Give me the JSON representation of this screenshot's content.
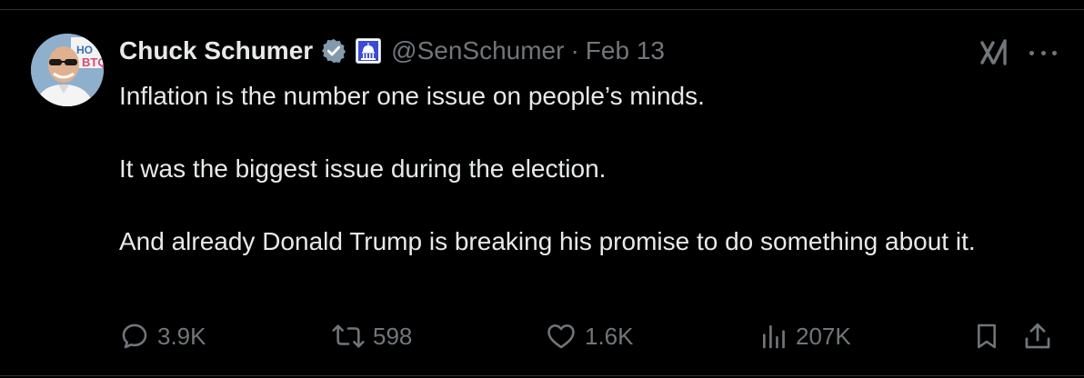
{
  "tweet": {
    "author_name": "Chuck Schumer",
    "handle": "@SenSchumer",
    "separator": "·",
    "date": "Feb 13",
    "body": [
      "Inflation is the number one issue on people’s minds.",
      "",
      "It was the biggest issue during the election.",
      "",
      "And already Donald Trump is breaking his promise to do something about it."
    ],
    "stats": {
      "replies": "3.9K",
      "reposts": "598",
      "likes": "1.6K",
      "views": "207K"
    }
  },
  "icons": {
    "verified": "verified-badge-icon",
    "affiliation": "capitol-building-icon",
    "grok": "grok-icon",
    "more": "more-icon",
    "reply": "reply-icon",
    "repost": "repost-icon",
    "like": "like-icon",
    "views": "views-icon",
    "bookmark": "bookmark-icon",
    "share": "share-icon"
  },
  "colors": {
    "background": "#000000",
    "text": "#e7e9ea",
    "secondary": "#71767b",
    "affiliation_badge": "#3b4bd6"
  }
}
